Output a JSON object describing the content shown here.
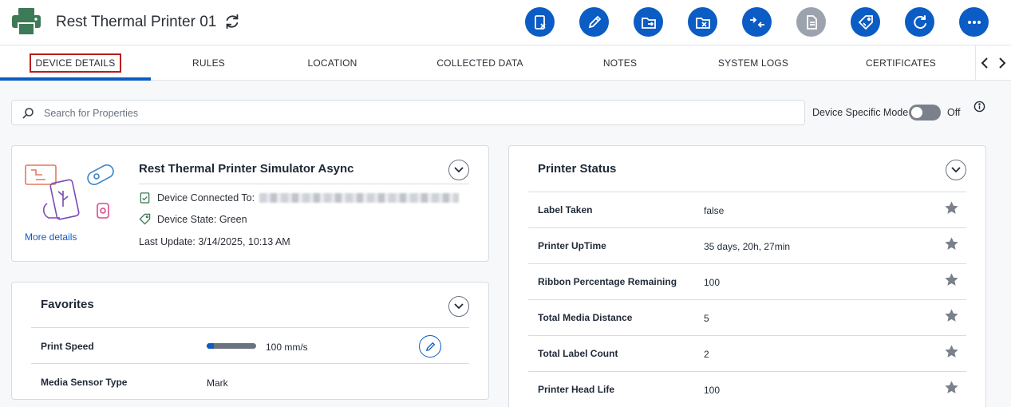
{
  "header": {
    "title": "Rest Thermal Printer 01",
    "icons": {
      "device": "printer-icon",
      "refresh": "refresh-icon"
    },
    "actions": [
      {
        "name": "remove-device-button",
        "icon": "device-x-icon",
        "disabled": false
      },
      {
        "name": "edit-button",
        "icon": "pencil-icon",
        "disabled": false
      },
      {
        "name": "move-folder-button",
        "icon": "folder-move-icon",
        "disabled": false
      },
      {
        "name": "remove-folder-button",
        "icon": "folder-x-icon",
        "disabled": false
      },
      {
        "name": "transfer-button",
        "icon": "arrows-in-icon",
        "disabled": false
      },
      {
        "name": "document-button",
        "icon": "document-icon",
        "disabled": true
      },
      {
        "name": "tag-button",
        "icon": "tag-icon",
        "disabled": false
      },
      {
        "name": "reload-button",
        "icon": "reload-icon",
        "disabled": false
      },
      {
        "name": "more-button",
        "icon": "more-dots-icon",
        "disabled": false
      }
    ]
  },
  "tabs": [
    {
      "label": "DEVICE DETAILS",
      "active": true
    },
    {
      "label": "RULES"
    },
    {
      "label": "LOCATION"
    },
    {
      "label": "COLLECTED DATA"
    },
    {
      "label": "NOTES"
    },
    {
      "label": "SYSTEM LOGS"
    },
    {
      "label": "CERTIFICATES"
    }
  ],
  "search": {
    "placeholder": "Search for Properties",
    "value": ""
  },
  "mode": {
    "label": "Device Specific Mode",
    "state": "Off"
  },
  "device_card": {
    "name": "Rest Thermal Printer Simulator Async",
    "connected_label": "Device Connected To:",
    "state_label": "Device State: Green",
    "last_update": "Last Update: 3/14/2025, 10:13 AM",
    "more_details": "More details"
  },
  "favorites": {
    "title": "Favorites",
    "rows": [
      {
        "label": "Print Speed",
        "value": "100 mm/s",
        "level": 0.15
      },
      {
        "label": "Media Sensor Type",
        "value": "Mark"
      }
    ]
  },
  "printer_status": {
    "title": "Printer Status",
    "rows": [
      {
        "label": "Label Taken",
        "value": "false"
      },
      {
        "label": "Printer UpTime",
        "value": "35 days, 20h, 27min"
      },
      {
        "label": "Ribbon Percentage Remaining",
        "value": "100"
      },
      {
        "label": "Total Media Distance",
        "value": "5"
      },
      {
        "label": "Total Label Count",
        "value": "2"
      },
      {
        "label": "Printer Head Life",
        "value": "100"
      }
    ]
  },
  "colors": {
    "accent": "#0b5cc4",
    "disabled": "#9ca3af",
    "active_tab_outline": "#b91c1c"
  }
}
